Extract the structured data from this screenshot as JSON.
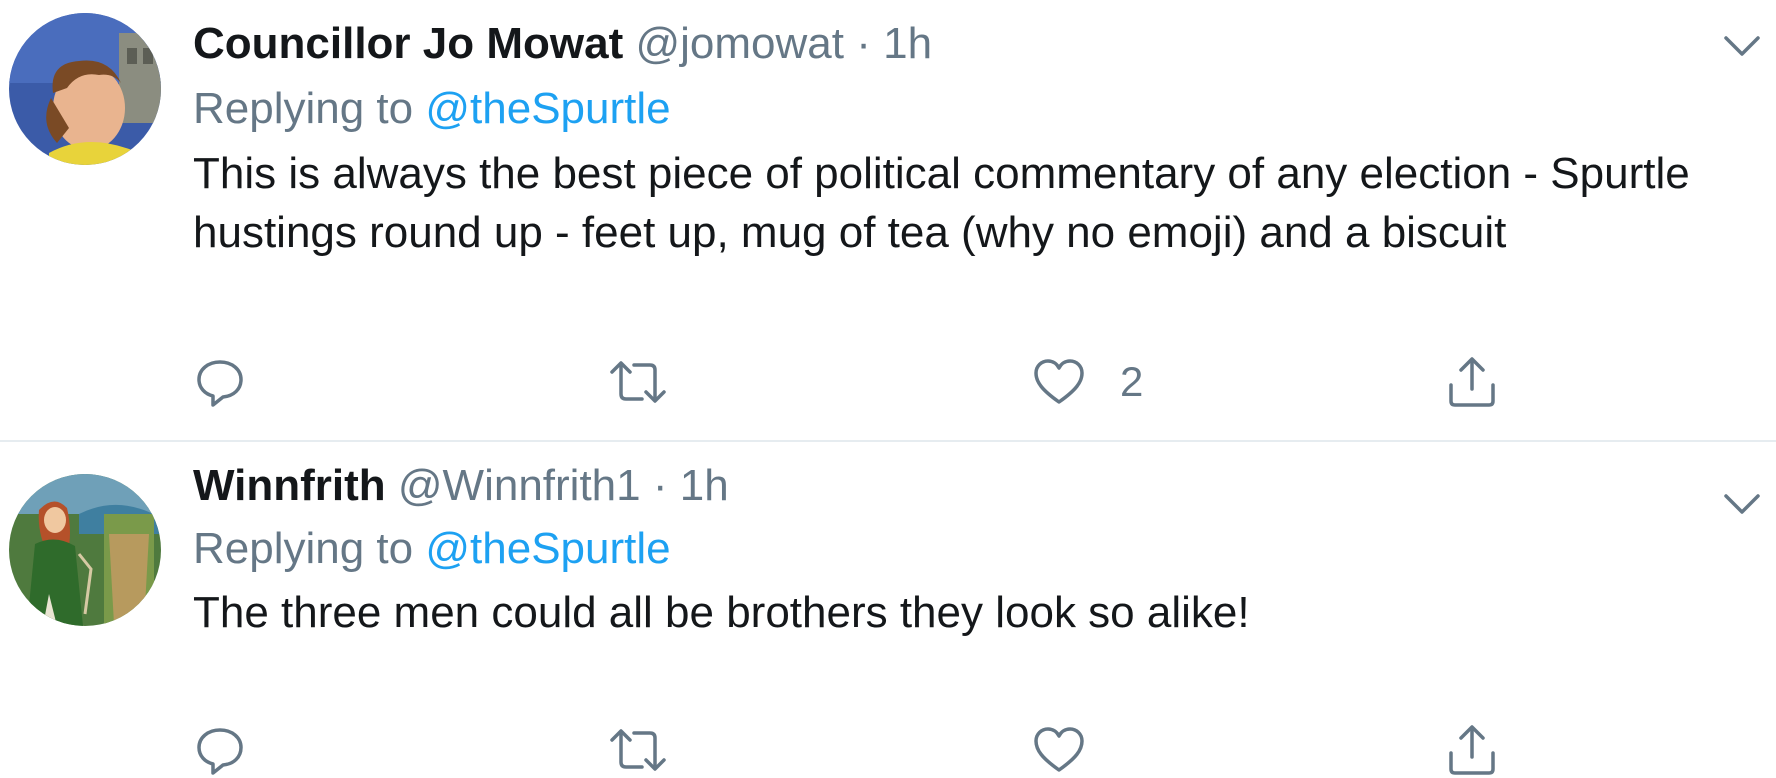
{
  "tweets": [
    {
      "display_name": "Councillor Jo Mowat",
      "handle": "@jomowat",
      "separator": "·",
      "time": "1h",
      "replying_prefix": "Replying to",
      "replying_to": "@theSpurtle",
      "text": "This is always the best piece of political commentary of any election - Spurtle hustings round up - feet up, mug of tea (why no emoji) and a biscuit",
      "like_count": "2",
      "avatar_icon": "profile-photo-person-face",
      "colors": {
        "avatar_bg": "#3b5ba8"
      }
    },
    {
      "display_name": "Winnfrith",
      "handle": "@Winnfrith1",
      "separator": "·",
      "time": "1h",
      "replying_prefix": "Replying to",
      "replying_to": "@theSpurtle",
      "text": "The three men could all be brothers they look so alike!",
      "like_count": "",
      "avatar_icon": "profile-illustration-woman-in-green",
      "colors": {
        "avatar_bg": "#4f7a3e"
      }
    }
  ],
  "icons": {
    "reply": "reply-icon",
    "retweet": "retweet-icon",
    "like": "like-icon",
    "share": "share-icon",
    "menu": "chevron-down-icon"
  },
  "colors": {
    "name": "#14171a",
    "secondary": "#657786",
    "mention": "#1da1f2",
    "divider": "#e6ecf0"
  }
}
